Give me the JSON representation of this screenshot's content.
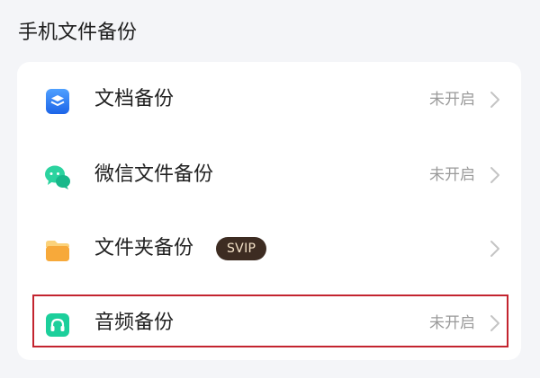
{
  "section": {
    "title": "手机文件备份"
  },
  "items": [
    {
      "label": "文档备份",
      "status": "未开启",
      "icon": "document-stack-icon",
      "color": "#2f7cf6"
    },
    {
      "label": "微信文件备份",
      "status": "未开启",
      "icon": "wechat-icon",
      "color": "#1fcf9a"
    },
    {
      "label": "文件夹备份",
      "badge": "SVIP",
      "status": "",
      "icon": "folder-icon",
      "color": "#f7b23b"
    },
    {
      "label": "音频备份",
      "status": "未开启",
      "icon": "headphones-icon",
      "color": "#1ccf9b"
    }
  ],
  "colors": {
    "highlight_border": "#c3242f",
    "badge_bg": "#3d2c22",
    "badge_text": "#f4e2c8"
  }
}
